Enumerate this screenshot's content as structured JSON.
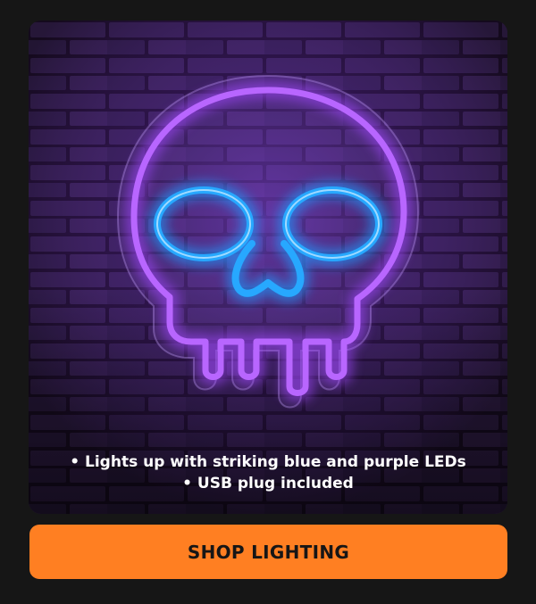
{
  "hero": {
    "image_icon": "neon-skull-sign",
    "colors": {
      "wall": "#2a1740",
      "brick": "#3a2356",
      "neon_purple": "#a247ff",
      "neon_blue": "#1e9bff"
    },
    "bullets": [
      "• Lights up with striking blue and purple LEDs",
      "• USB plug included"
    ]
  },
  "cta": {
    "label": "SHOP LIGHTING",
    "color": "#ff7f22"
  }
}
